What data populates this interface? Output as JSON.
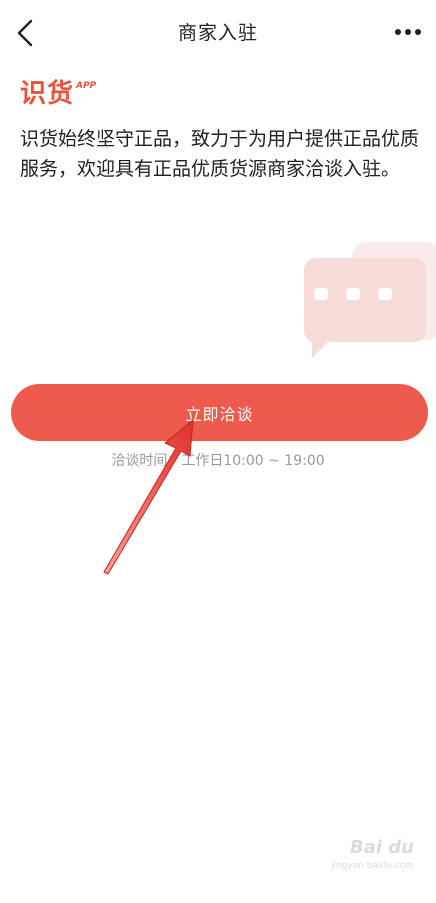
{
  "header": {
    "title": "商家入驻",
    "back_icon": "chevron-left-icon",
    "more_icon": "more-dots-icon"
  },
  "logo": {
    "main": "识货",
    "sup": "APP",
    "color": "#e8533e"
  },
  "description": "识货始终坚守正品，致力于为用户提供正品优质服务，欢迎具有正品优质货源商家洽谈入驻。",
  "cta": {
    "label": "立即洽谈",
    "color": "#ee5b4c"
  },
  "hours": "洽谈时间：工作日10:00 ~ 19:00",
  "watermark": {
    "brand": "Bai du",
    "url": "jingyan.baidu.com"
  },
  "annotation": {
    "arrow_color": "#e0302a",
    "arrow_icon": "red-arrow-icon"
  }
}
